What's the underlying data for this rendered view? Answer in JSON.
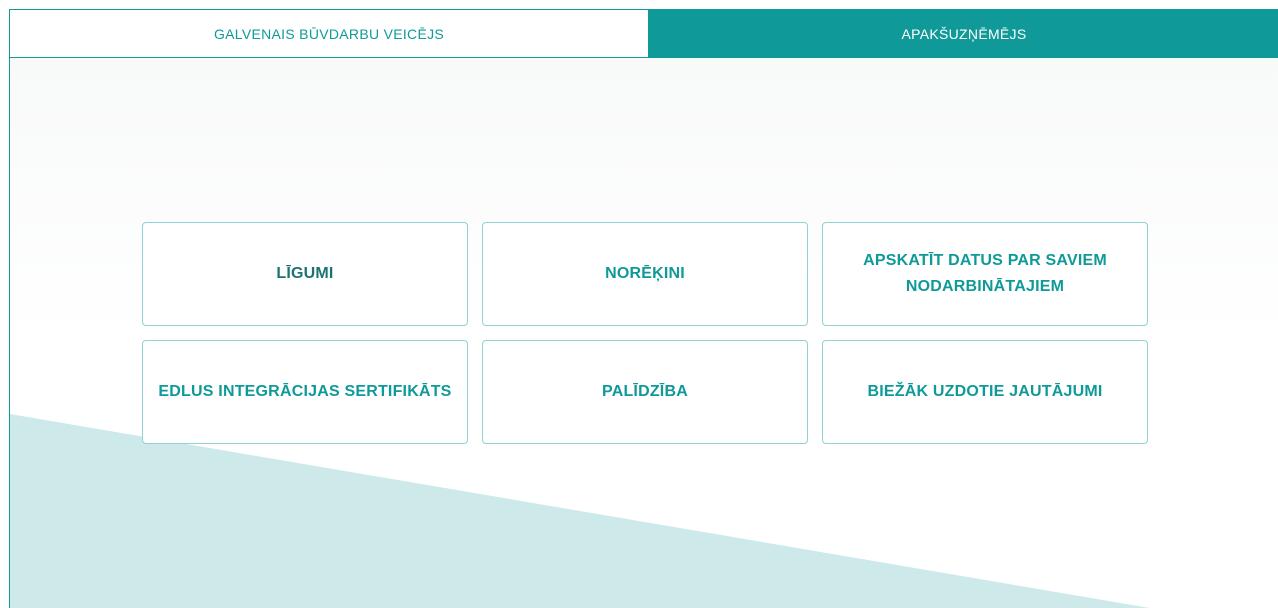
{
  "tabs": {
    "main_label": "GALVENAIS BŪVDARBU VEICĒJS",
    "sub_label": "APAKŠUZŅĒMĒJS",
    "active": "main"
  },
  "colors": {
    "accent": "#0f9a99",
    "tile_border": "#8fd2d0",
    "background_shape": "#cde9ea"
  },
  "tiles": [
    {
      "label": "LĪGUMI"
    },
    {
      "label": "NORĒĶINI"
    },
    {
      "label": "APSKATĪT DATUS PAR SAVIEM NODARBINĀTAJIEM"
    },
    {
      "label": "EDLUS INTEGRĀCIJAS SERTIFIKĀTS"
    },
    {
      "label": "PALĪDZĪBA"
    },
    {
      "label": "BIEŽĀK UZDOTIE JAUTĀJUMI"
    }
  ]
}
